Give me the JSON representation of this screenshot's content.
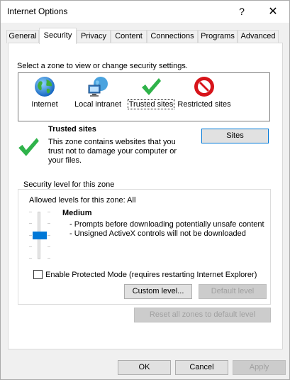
{
  "window": {
    "title": "Internet Options",
    "help_glyph": "?",
    "close_glyph": "✕"
  },
  "tabs": [
    {
      "label": "General",
      "active": false
    },
    {
      "label": "Security",
      "active": true
    },
    {
      "label": "Privacy",
      "active": false
    },
    {
      "label": "Content",
      "active": false
    },
    {
      "label": "Connections",
      "active": false
    },
    {
      "label": "Programs",
      "active": false
    },
    {
      "label": "Advanced",
      "active": false
    }
  ],
  "security": {
    "zone_prompt": "Select a zone to view or change security settings.",
    "zones": [
      {
        "label": "Internet",
        "icon": "globe-icon"
      },
      {
        "label": "Local intranet",
        "icon": "intranet-icon"
      },
      {
        "label": "Trusted sites",
        "icon": "green-check-icon",
        "selected": true
      },
      {
        "label": "Restricted sites",
        "icon": "no-entry-icon"
      }
    ],
    "selected_zone_title": "Trusted sites",
    "selected_zone_desc": "This zone contains websites that you trust not to damage your computer or your files.",
    "sites_button": "Sites",
    "level_group_label": "Security level for this zone",
    "allowed_levels": "Allowed levels for this zone: All",
    "level_name": "Medium",
    "level_lines": [
      "- Prompts before downloading potentially unsafe content",
      "- Unsigned ActiveX controls will not be downloaded"
    ],
    "slider_level": "Medium (2 of 5)",
    "protected_mode_label": "Enable Protected Mode (requires restarting Internet Explorer)",
    "protected_mode_checked": false,
    "custom_level_button": "Custom level...",
    "default_level_button": "Default level",
    "reset_all_button": "Reset all zones to default level"
  },
  "footer": {
    "ok": "OK",
    "cancel": "Cancel",
    "apply": "Apply"
  },
  "colors": {
    "accent": "#0078d7",
    "check_green": "#2fb34a",
    "restricted_red": "#d7141a"
  }
}
